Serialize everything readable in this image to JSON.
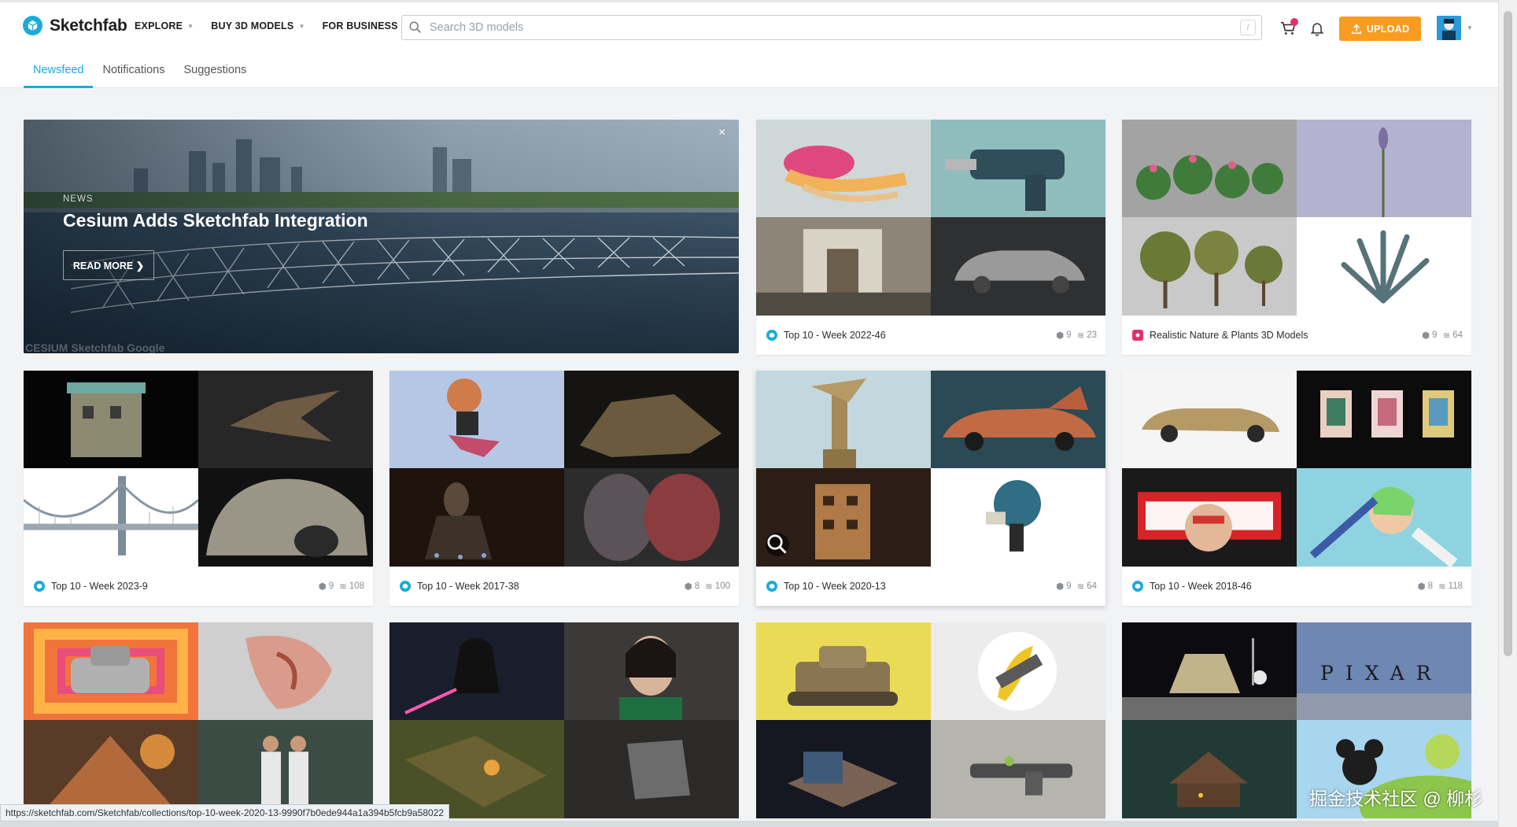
{
  "header": {
    "logo_text": "Sketchfab",
    "nav": [
      {
        "label": "EXPLORE"
      },
      {
        "label": "BUY 3D MODELS"
      },
      {
        "label": "FOR BUSINESS"
      }
    ],
    "search_placeholder": "Search 3D models",
    "search_shortcut": "/",
    "upload_label": "UPLOAD",
    "colors": {
      "accent": "#1caad9",
      "upload": "#f89d22",
      "badge": "#e2306c"
    }
  },
  "tabs": [
    {
      "label": "Newsfeed",
      "active": true
    },
    {
      "label": "Notifications",
      "active": false
    },
    {
      "label": "Suggestions",
      "active": false
    }
  ],
  "hero": {
    "label": "NEWS",
    "title": "Cesium Adds Sketchfab Integration",
    "button": "READ MORE ❯",
    "close": "×",
    "credit": "CESIUM   Sketchfab   Google"
  },
  "cards": [
    {
      "title": "Top 10 - Week 2022-46",
      "models": "9",
      "followers": "23"
    },
    {
      "title": "Realistic Nature & Plants 3D Models",
      "models": "9",
      "followers": "64"
    },
    {
      "title": "Top 10 - Week 2023-9",
      "models": "9",
      "followers": "108"
    },
    {
      "title": "Top 10 - Week 2017-38",
      "models": "8",
      "followers": "100"
    },
    {
      "title": "Top 10 - Week 2020-13",
      "models": "9",
      "followers": "64"
    },
    {
      "title": "Top 10 - Week 2018-46",
      "models": "8",
      "followers": "118"
    }
  ],
  "status_url": "https://sketchfab.com/Sketchfab/collections/top-10-week-2020-13-9990f7b0ede944a1a394b5fcb9a58022",
  "watermark": "掘金技术社区 @ 柳杉"
}
